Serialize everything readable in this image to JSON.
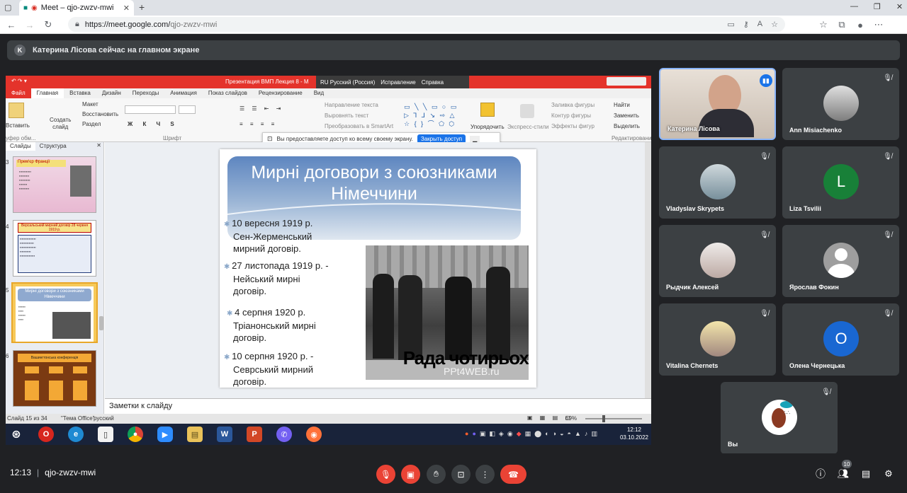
{
  "browser": {
    "tab_title": "Meet – qjo-zwzv-mwi",
    "new_tab_symbol": "+",
    "url_host": "https://meet.google.com/",
    "url_path": "qjo-zwzv-mwi"
  },
  "banner": {
    "initial": "K",
    "text": "Катерина Лісова сейчас на главном экране"
  },
  "ppt": {
    "title": "Презентация ВМП Лекция 8 - М",
    "lang": "RU Русский (Россия)",
    "fix": "Исправление",
    "help": "Справка",
    "tabs": [
      "Файл",
      "Главная",
      "Вставка",
      "Дизайн",
      "Переходы",
      "Анимация",
      "Показ слайдов",
      "Рецензирование",
      "Вид"
    ],
    "ribbon": {
      "paste": "Вставить",
      "layout": "Макет",
      "restore": "Восстановить",
      "section": "Раздел",
      "create": "Создать",
      "slide": "слайд",
      "buffer": "уфер обм...",
      "font_group": "Шрифт",
      "text_direction": "Направление текста",
      "align_text": "Выровнять текст",
      "smartart": "Преобразовать в SmartArt",
      "arrange": "Упорядочить",
      "express": "Экспресс-стили",
      "fill": "Заливка фигуры",
      "outline": "Контур фигуры",
      "effects": "Эффекты фигур",
      "find": "Найти",
      "replace": "Заменить",
      "select": "Выделить",
      "editing": "Редактирование"
    },
    "share_notice": "Вы предоставляете доступ ко всему своему экрану.",
    "stop_share": "Закрыть доступ",
    "panel_tabs": [
      "Слайды",
      "Структура"
    ],
    "thumbs": [
      {
        "num": "3",
        "title": "Прем'єр Франції"
      },
      {
        "num": "4",
        "title": "Версальський мирний договір 28 червня 1919 р."
      },
      {
        "num": "5",
        "title": "Мирні договори з союзниками Німеччини"
      },
      {
        "num": "6",
        "title": "Вашингтонська конференція"
      }
    ],
    "slide": {
      "title_line1": "Мирні договори з союзниками",
      "title_line2": "Німеччини",
      "bullets": [
        {
          "line1": "10 вересня 1919 р.",
          "line2": "Сен-Жерменський",
          "line3": "мирний договір."
        },
        {
          "line1": "27 листопада 1919 р. -",
          "line2": "Нейський мирні",
          "line3": "договір."
        },
        {
          "line1": "4 серпня 1920 р.",
          "line2": "Тріанонський мирні",
          "line3": "договір."
        },
        {
          "line1": "10 серпня 1920 р. -",
          "line2": "Севрський мирний",
          "line3": "договір."
        }
      ],
      "photo_caption": "Рада чотирьох",
      "watermark": "PPt4WEB.ru"
    },
    "notes_placeholder": "Заметки к слайду",
    "status": {
      "slide_of": "Слайд 15 из 34",
      "theme": "\"Тема Office\"",
      "language": "русский",
      "zoom": "69%"
    },
    "clock_time": "12:12",
    "clock_date": "03.10.2022"
  },
  "participants": [
    {
      "name": "Катерина Лісова",
      "initial": "",
      "color": "#8d6e63",
      "speaking": true
    },
    {
      "name": "Ann Misiachenko",
      "initial": "",
      "color": "#bdbdbd"
    },
    {
      "name": "Vladyslav Skrypets",
      "initial": "",
      "color": "#90a4ae"
    },
    {
      "name": "Liza Tsvilii",
      "initial": "L",
      "color": "#188038"
    },
    {
      "name": "Рыдчик Алексей",
      "initial": "",
      "color": "#d7ccc8"
    },
    {
      "name": "Ярослав Фокин",
      "initial": "",
      "color": "#9e9e9e"
    },
    {
      "name": "Vitalina Chernets",
      "initial": "",
      "color": "#c5a880"
    },
    {
      "name": "Олена Чернецька",
      "initial": "O",
      "color": "#1967d2"
    },
    {
      "name": "Вы",
      "initial": "",
      "color": "#ffffff"
    }
  ],
  "meeting": {
    "time": "12:13",
    "code": "qjo-zwzv-mwi",
    "participant_count": "10"
  }
}
